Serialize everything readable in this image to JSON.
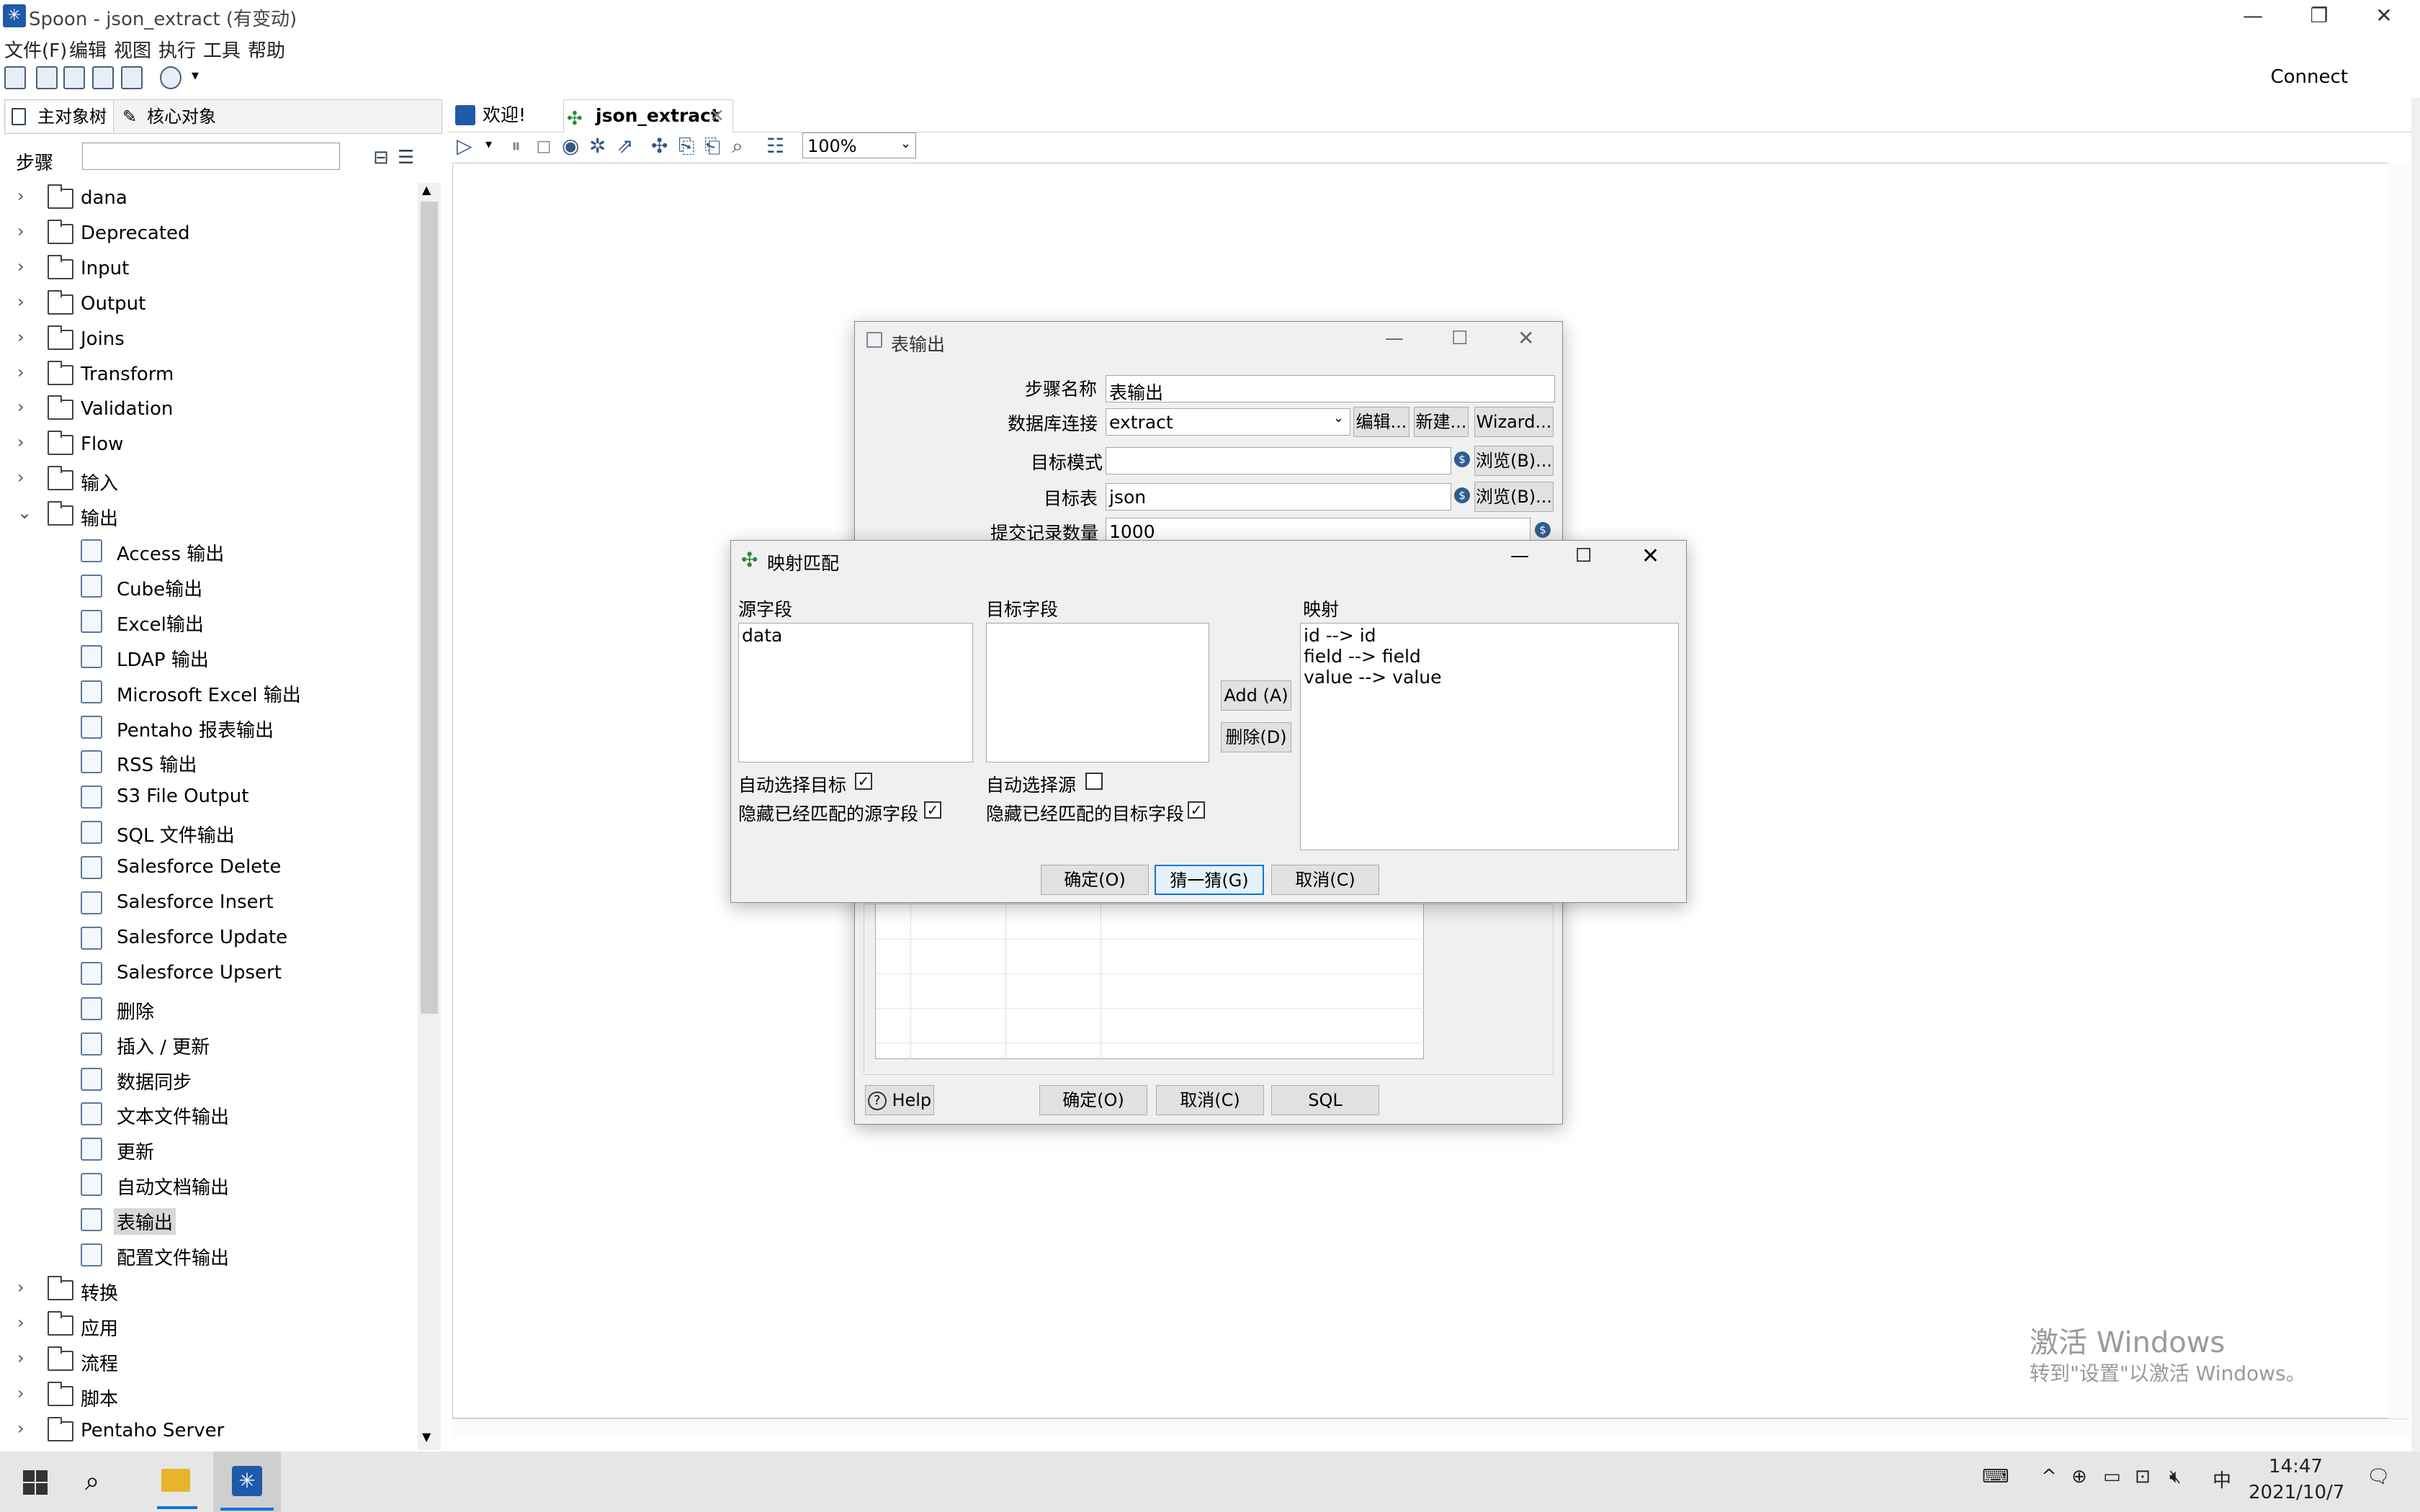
{
  "window": {
    "title": "Spoon - json_extract (有变动)",
    "minimize": "—",
    "restore": "❐",
    "close": "✕"
  },
  "menu": [
    "文件(F)",
    "编辑",
    "视图",
    "执行",
    "工具",
    "帮助"
  ],
  "toolbar": {
    "connect": "Connect"
  },
  "left_panel": {
    "tabs": [
      "主对象树",
      "核心对象"
    ],
    "steps_label": "步骤",
    "search_value": "",
    "tree": [
      {
        "label": "dana",
        "type": "folder",
        "expanded": false
      },
      {
        "label": "Deprecated",
        "type": "folder",
        "expanded": false
      },
      {
        "label": "Input",
        "type": "folder",
        "expanded": false
      },
      {
        "label": "Output",
        "type": "folder",
        "expanded": false
      },
      {
        "label": "Joins",
        "type": "folder",
        "expanded": false
      },
      {
        "label": "Transform",
        "type": "folder",
        "expanded": false
      },
      {
        "label": "Validation",
        "type": "folder",
        "expanded": false
      },
      {
        "label": "Flow",
        "type": "folder",
        "expanded": false
      },
      {
        "label": "输入",
        "type": "folder",
        "expanded": false
      },
      {
        "label": "输出",
        "type": "folder",
        "expanded": true
      },
      {
        "label": "Access 输出",
        "type": "step"
      },
      {
        "label": "Cube输出",
        "type": "step"
      },
      {
        "label": "Excel输出",
        "type": "step"
      },
      {
        "label": "LDAP 输出",
        "type": "step"
      },
      {
        "label": "Microsoft Excel 输出",
        "type": "step"
      },
      {
        "label": "Pentaho 报表输出",
        "type": "step"
      },
      {
        "label": "RSS 输出",
        "type": "step"
      },
      {
        "label": "S3 File Output",
        "type": "step"
      },
      {
        "label": "SQL 文件输出",
        "type": "step"
      },
      {
        "label": "Salesforce Delete",
        "type": "step"
      },
      {
        "label": "Salesforce Insert",
        "type": "step"
      },
      {
        "label": "Salesforce Update",
        "type": "step"
      },
      {
        "label": "Salesforce Upsert",
        "type": "step"
      },
      {
        "label": "删除",
        "type": "step"
      },
      {
        "label": "插入 / 更新",
        "type": "step"
      },
      {
        "label": "数据同步",
        "type": "step"
      },
      {
        "label": "文本文件输出",
        "type": "step"
      },
      {
        "label": "更新",
        "type": "step"
      },
      {
        "label": "自动文档输出",
        "type": "step"
      },
      {
        "label": "表输出",
        "type": "step",
        "selected": true
      },
      {
        "label": "配置文件输出",
        "type": "step"
      },
      {
        "label": "转换",
        "type": "folder",
        "expanded": false
      },
      {
        "label": "应用",
        "type": "folder",
        "expanded": false
      },
      {
        "label": "流程",
        "type": "folder",
        "expanded": false
      },
      {
        "label": "脚本",
        "type": "folder",
        "expanded": false
      },
      {
        "label": "Pentaho Server",
        "type": "folder",
        "expanded": false
      }
    ]
  },
  "editor": {
    "tabs": [
      "欢迎!",
      "json_extract"
    ],
    "zoom": "100%"
  },
  "table_output_dialog": {
    "title": "表输出",
    "step_name_label": "步骤名称",
    "step_name_value": "表输出",
    "db_conn_label": "数据库连接",
    "db_conn_value": "extract",
    "edit_btn": "编辑...",
    "new_btn": "新建...",
    "wizard_btn": "Wizard...",
    "target_schema_label": "目标模式",
    "target_schema_value": "",
    "browse_btn": "浏览(B)...",
    "target_table_label": "目标表",
    "target_table_value": "json",
    "commit_size_label": "提交记录数量",
    "commit_size_value": "1000",
    "help_btn": "Help",
    "ok_btn": "确定(O)",
    "cancel_btn": "取消(C)",
    "sql_btn": "SQL"
  },
  "mapping_dialog": {
    "title": "映射匹配",
    "source_label": "源字段",
    "source_fields": [
      "data"
    ],
    "target_label": "目标字段",
    "target_fields": [],
    "mapping_label": "映射",
    "mappings": [
      "id --> id",
      "field --> field",
      "value --> value"
    ],
    "add_btn": "Add (A)",
    "delete_btn": "删除(D)",
    "auto_target_label": "自动选择目标",
    "auto_target_checked": true,
    "hide_source_label": "隐藏已经匹配的源字段",
    "hide_source_checked": true,
    "auto_source_label": "自动选择源",
    "auto_source_checked": false,
    "hide_target_label": "隐藏已经匹配的目标字段",
    "hide_target_checked": true,
    "ok_btn": "确定(O)",
    "guess_btn": "猜一猜(G)",
    "cancel_btn": "取消(C)"
  },
  "watermark": {
    "line1": "激活 Windows",
    "line2": "转到\"设置\"以激活 Windows。"
  },
  "taskbar": {
    "ime": "中",
    "time": "14:47",
    "date": "2021/10/7"
  }
}
